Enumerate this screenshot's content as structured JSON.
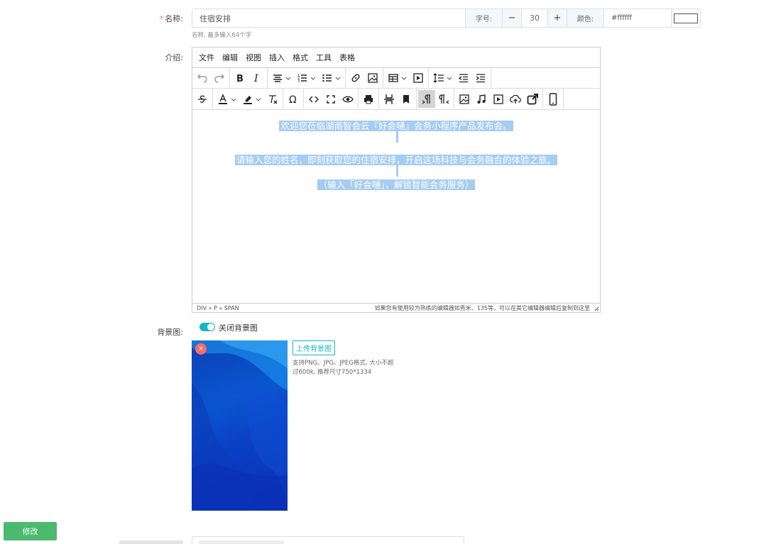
{
  "form": {
    "name_label": "名称:",
    "name_required": "*",
    "name_value": "住宿安排",
    "name_hint": "名称, 最多输入64个字",
    "font_size_label": "字号:",
    "font_size_value": "30",
    "minus": "−",
    "plus": "+",
    "color_label": "颜色:",
    "color_value": "#ffffff",
    "swatch_color": "#ffffff",
    "intro_label": "介绍:",
    "bg_label": "背景图:",
    "bg_toggle_label": "关闭背景图",
    "bg_toggle_on": true,
    "upload_label": "上传背景图",
    "upload_tip": "支持PNG、JPG、JPEG格式, 大小不超过600k, 推荐尺寸750*1334",
    "remove_symbol": "×",
    "submit_label": "修改"
  },
  "editor": {
    "menus": [
      "文件",
      "编辑",
      "视图",
      "插入",
      "格式",
      "工具",
      "表格"
    ],
    "content": {
      "line1": "欢迎您莅临湖南智会云『好会嗵』会务小程序产品发布会。",
      "line2": "请输入您的姓名，即刻获取您的住宿安排，开启这场科技与会务融合的体验之旅。",
      "line3": "（输入「好会嗵」，解锁智能会务服务）"
    },
    "status_path": "DIV » P » SPAN",
    "status_tip": "如果您有使用较为熟练的编辑器如秀米、135等，可以在其它编辑器编辑后复制到这里"
  },
  "colors": {
    "accent": "#13b5c8",
    "submit": "#4cba6e",
    "danger": "#f56c6c",
    "selection": "#a5ccf2"
  }
}
